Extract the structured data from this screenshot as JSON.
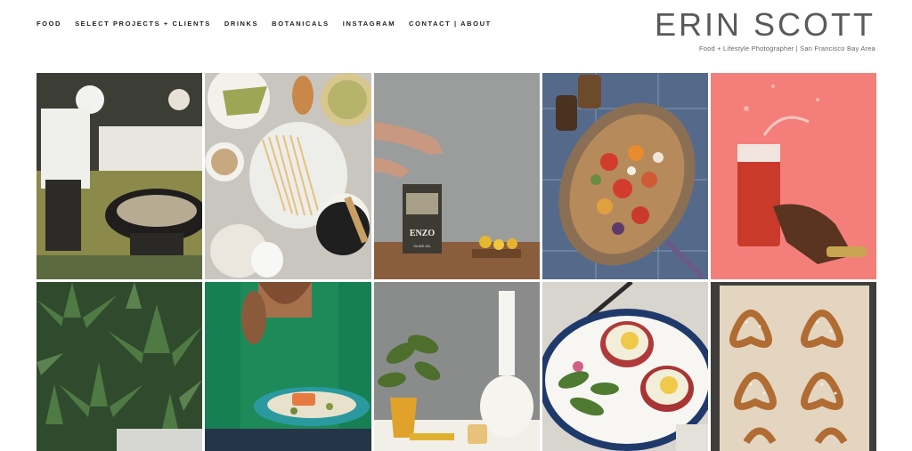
{
  "nav": {
    "items": [
      {
        "label": "FOOD"
      },
      {
        "label": "SELECT PROJECTS + CLIENTS"
      },
      {
        "label": "DRINKS"
      },
      {
        "label": "BOTANICALS"
      },
      {
        "label": "INSTAGRAM"
      },
      {
        "label": "CONTACT | ABOUT"
      }
    ]
  },
  "brand": {
    "name": "ERIN SCOTT",
    "tagline": "Food + Lifestyle Photographer | San Francisco Bay Area"
  },
  "gallery": {
    "tile_3_label": "ENZO",
    "tile_3_sublabel": "OLIVE OIL"
  }
}
